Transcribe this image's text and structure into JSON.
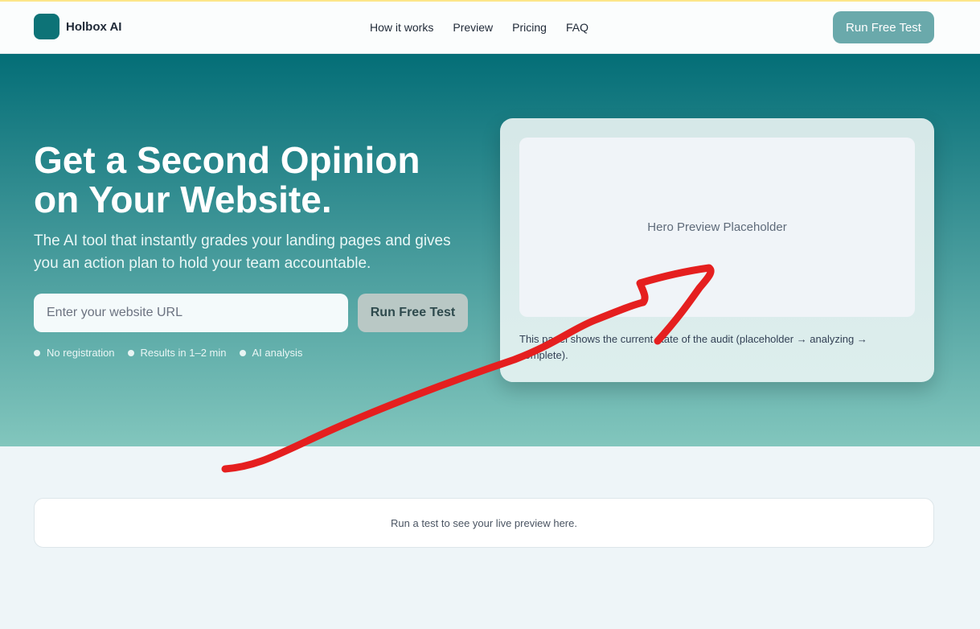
{
  "header": {
    "brand": "Holbox AI",
    "nav": [
      "How it works",
      "Preview",
      "Pricing",
      "FAQ"
    ],
    "cta": "Run Free Test"
  },
  "hero": {
    "title": "Get a Second Opinion on Your Website.",
    "subtitle": "The AI tool that instantly grades your landing pages and gives you an action plan to hold your team accountable.",
    "input_placeholder": "Enter your website URL",
    "button": "Run Free Test",
    "features": [
      "No registration",
      "Results in 1–2 min",
      "AI analysis"
    ]
  },
  "preview_card": {
    "placeholder": "Hero Preview Placeholder",
    "note": "This panel shows the current state of the audit (placeholder → analyzing → complete)."
  },
  "live_preview": {
    "text": "Run a test to see your live preview here."
  },
  "colors": {
    "brand": "#0d7377",
    "annotation": "#e51f1f"
  }
}
